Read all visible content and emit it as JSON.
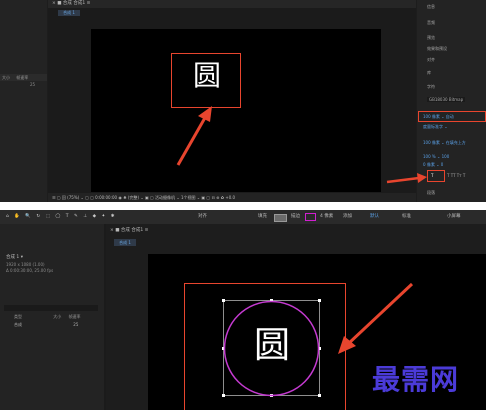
{
  "top": {
    "comp_header": "× ■ 合成 合成1 ≡",
    "comp_tab": "合成 1",
    "left_panel": {
      "col_size": "大小",
      "col_mode": "帧速率",
      "row_value": "25"
    },
    "glyph": "圆",
    "bottom_bar": "☰ ▢ 回 (75%)  ⌄  ▢ ▢ 0:00:00:00  ◉  ♣  (完整)  ⌄  ▣ ▢ 活动摄像机  ⌄  1个视图  ⌄  ▣ ▢ ⊟ ⊕ ✿ +0.0",
    "right_panel": {
      "items": [
        "信息",
        "音频",
        "预览",
        "效果和预设",
        "对齐",
        "库",
        "字符"
      ],
      "font_name": "GB18030 Bitmap",
      "size_row": "100 像素  ⌄   自动",
      "kern_row": "度量标准字  ⌄",
      "stroke_row": "100 像素  ⌄   在填充上方",
      "scale_row": "100 %   ⌄   100",
      "baseline_row": "0 像素  ⌄   0",
      "bold_btn": "T",
      "style_row": "T  TT  Tт  T",
      "para": "段落"
    }
  },
  "bottom": {
    "toolbar": {
      "tools": [
        "⌂",
        "✋",
        "🔍",
        "↻",
        "⬚",
        "◯",
        "T",
        "✎",
        "⊥",
        "◆",
        "✦",
        "✱"
      ],
      "align": "对齐",
      "fill": "填充",
      "fill_color": "#6b6b6b",
      "stroke": "描边",
      "stroke_color": "#d01fd0",
      "stroke_width": "4 像素",
      "add": "添加",
      "default": "默认",
      "study": "标准",
      "small_screen": "小屏幕"
    },
    "comp_header": "× ■ 合成 合成1 ≡",
    "comp_tab": "合成 1",
    "left_panel": {
      "name": "合成 1 ▾",
      "size": "1920 x 1080 (1.00)",
      "duration": "Δ 0:00:30:00, 25.00 fps",
      "col_type": "类型",
      "col_size": "大小",
      "col_fps": "帧速率",
      "row_name": "合成",
      "row_fps": "25"
    },
    "glyph": "圆",
    "circle_color": "#c43ad0",
    "watermark": "最需网"
  }
}
